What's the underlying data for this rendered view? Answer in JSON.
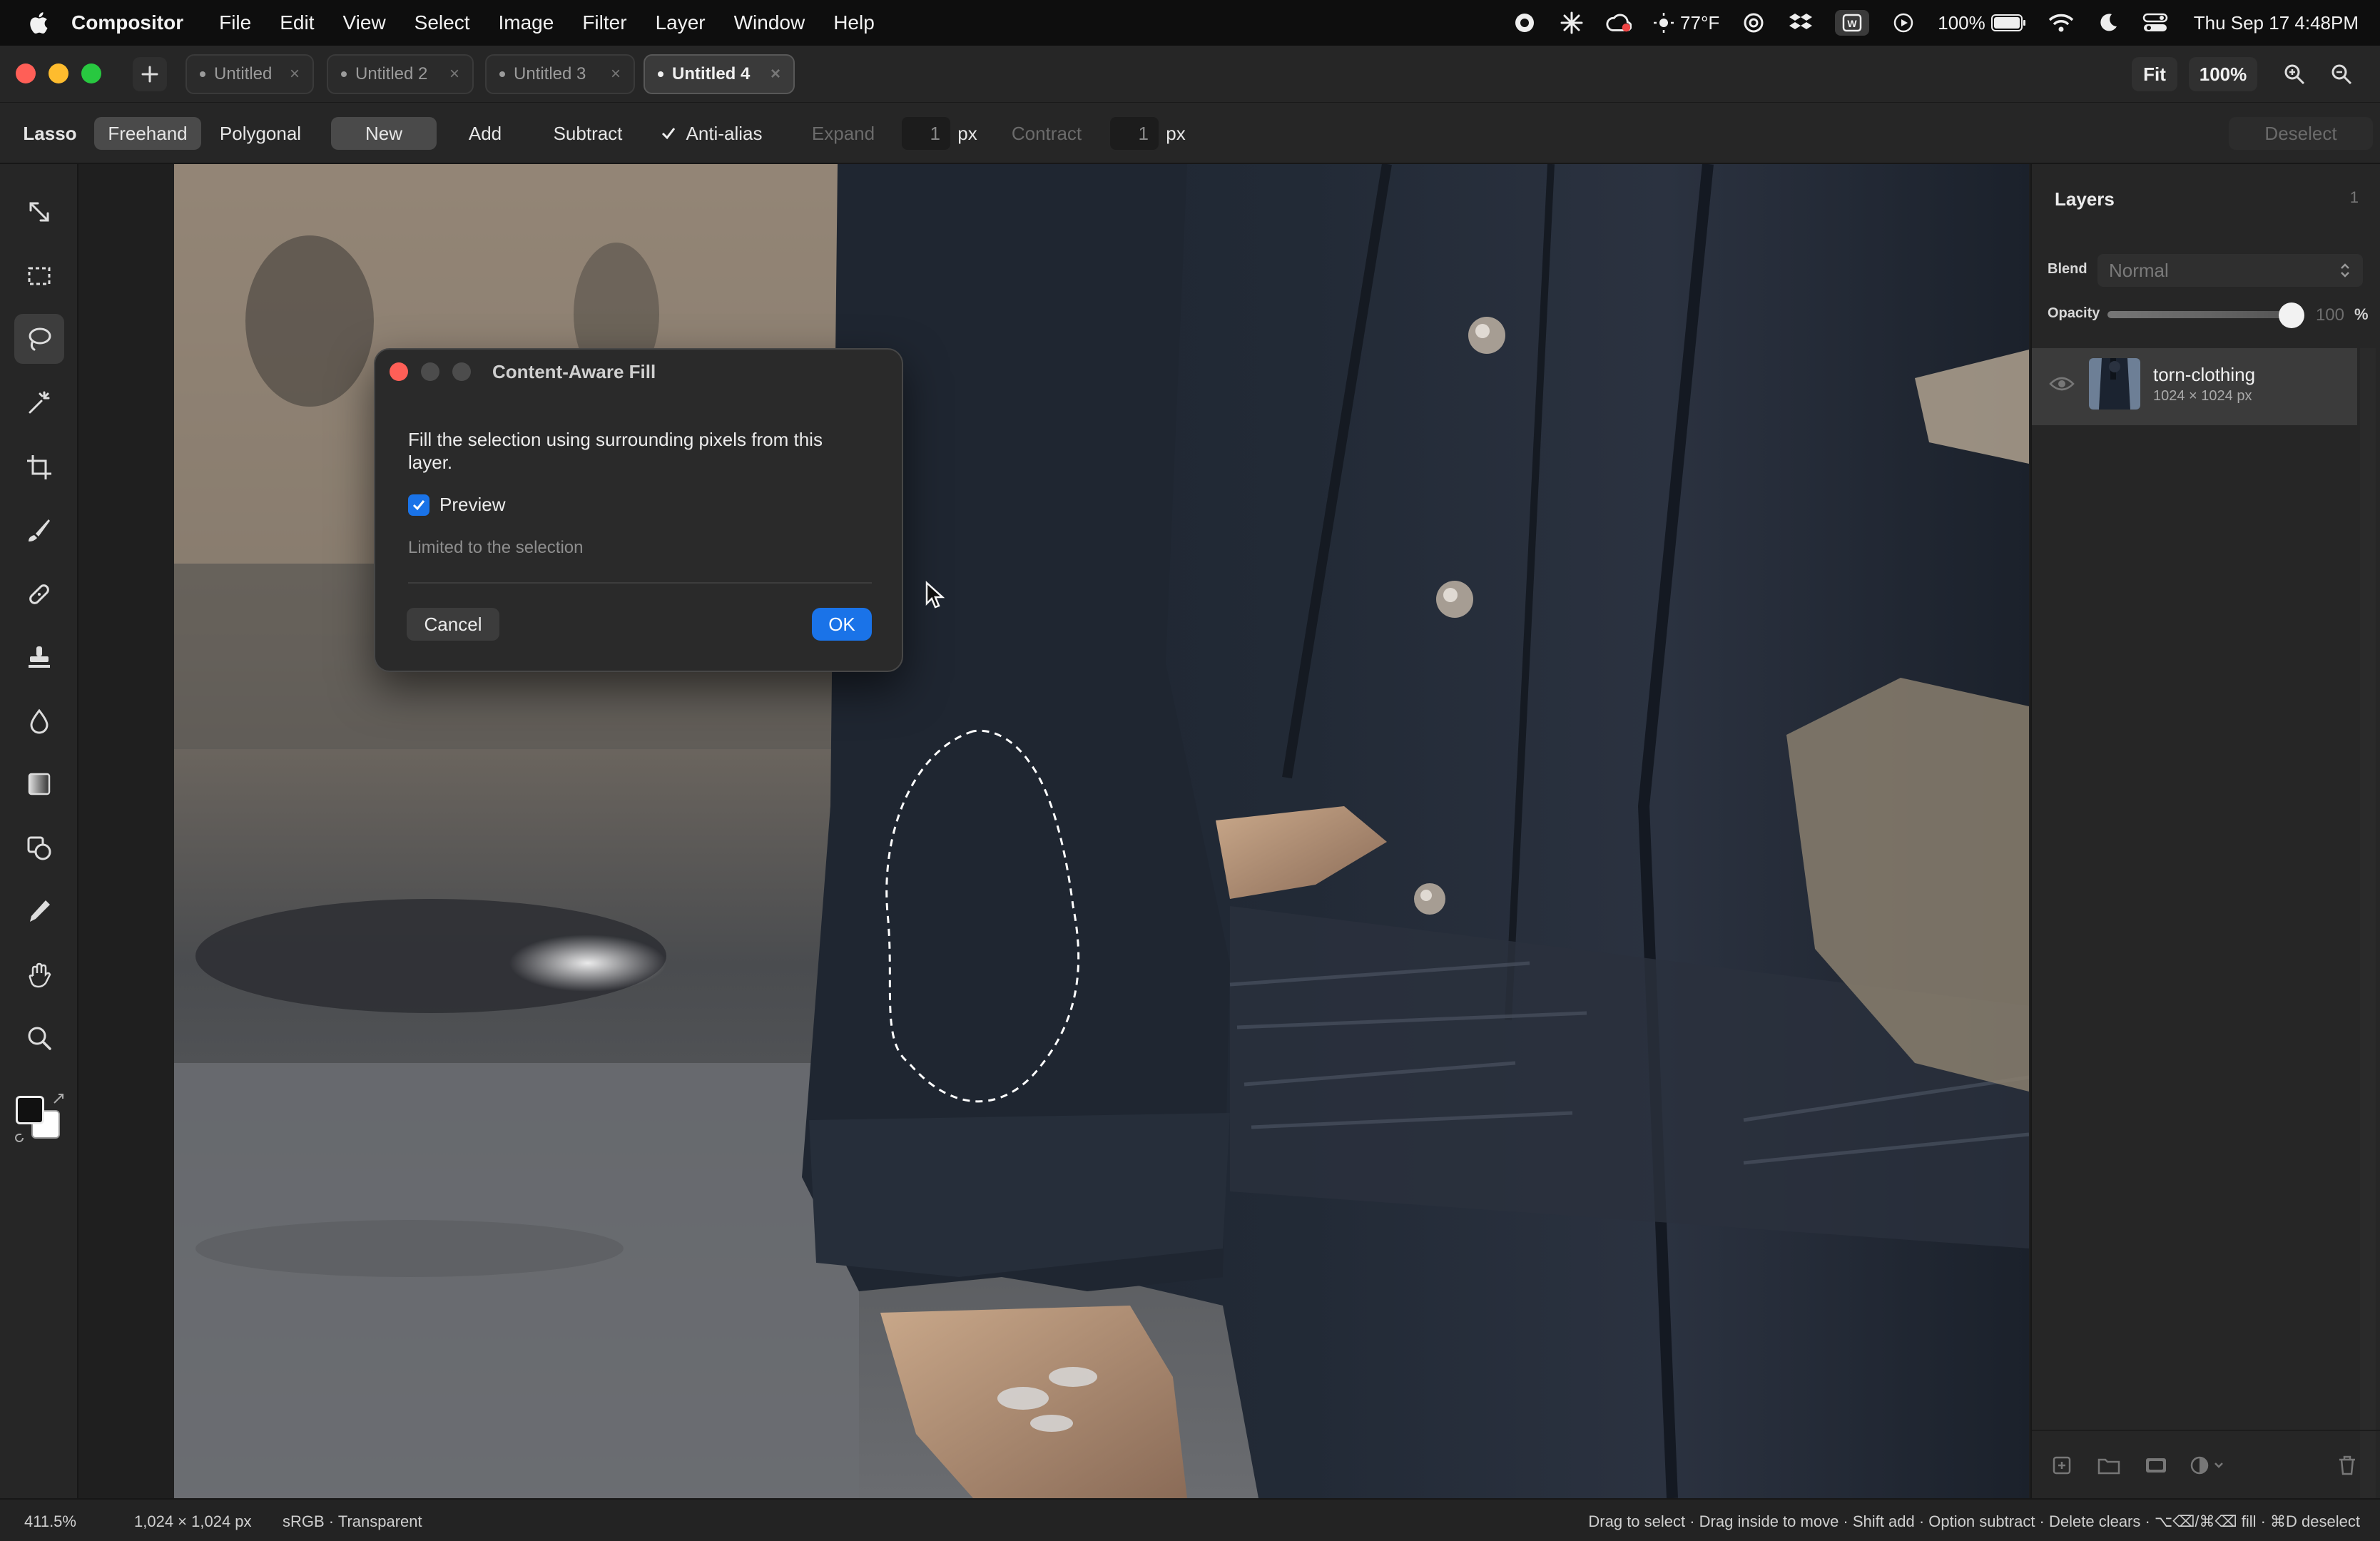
{
  "menubar": {
    "app": "Compositor",
    "menus": [
      "File",
      "Edit",
      "View",
      "Select",
      "Image",
      "Filter",
      "Layer",
      "Window",
      "Help"
    ],
    "weather": "77°F",
    "battery": "100%",
    "clock": "Thu Sep 17  4:48PM"
  },
  "tabs": [
    {
      "label": "Untitled",
      "active": false
    },
    {
      "label": "Untitled 2",
      "active": false
    },
    {
      "label": "Untitled 3",
      "active": false
    },
    {
      "label": "Untitled 4",
      "active": true
    }
  ],
  "tab_close_glyph": "×",
  "view": {
    "fit": "Fit",
    "zoom": "100%"
  },
  "options": {
    "tool": "Lasso",
    "freehand": "Freehand",
    "polygonal": "Polygonal",
    "new": "New",
    "add": "Add",
    "subtract": "Subtract",
    "antialias": "Anti-alias",
    "expand": "Expand",
    "expand_value": "1",
    "contract": "Contract",
    "contract_value": "1",
    "unit": "px",
    "deselect": "Deselect"
  },
  "tools": [
    "move-tool",
    "marquee-tool",
    "lasso-tool",
    "magic-wand-tool",
    "crop-tool",
    "brush-tool",
    "healing-tool",
    "stamp-tool",
    "blur-tool",
    "gradient-tool",
    "shape-tool",
    "eyedropper-tool",
    "hand-tool",
    "zoom-tool"
  ],
  "dialog": {
    "title": "Content-Aware Fill",
    "message": "Fill the selection using surrounding pixels from this layer.",
    "preview_label": "Preview",
    "preview_checked": true,
    "note": "Limited to the selection",
    "cancel": "Cancel",
    "ok": "OK"
  },
  "layers_panel": {
    "title": "Layers",
    "count": "1",
    "blend_label": "Blend",
    "blend_value": "Normal",
    "opacity_label": "Opacity",
    "opacity_value": "100",
    "opacity_unit": "%",
    "layers": [
      {
        "name": "torn-clothing",
        "size": "1024 × 1024 px"
      }
    ]
  },
  "statusbar": {
    "zoom": "411.5%",
    "dimensions": "1,024 × 1,024 px",
    "colorspace": "sRGB · Transparent",
    "hint": "Drag to select · Drag inside to move · Shift add · Option subtract · Delete clears · ⌥⌫/⌘⌫ fill · ⌘D deselect"
  },
  "colors": {
    "accent": "#1a73e8",
    "close": "#ff5f57",
    "minimize": "#febc2e",
    "maximize": "#28c840"
  }
}
